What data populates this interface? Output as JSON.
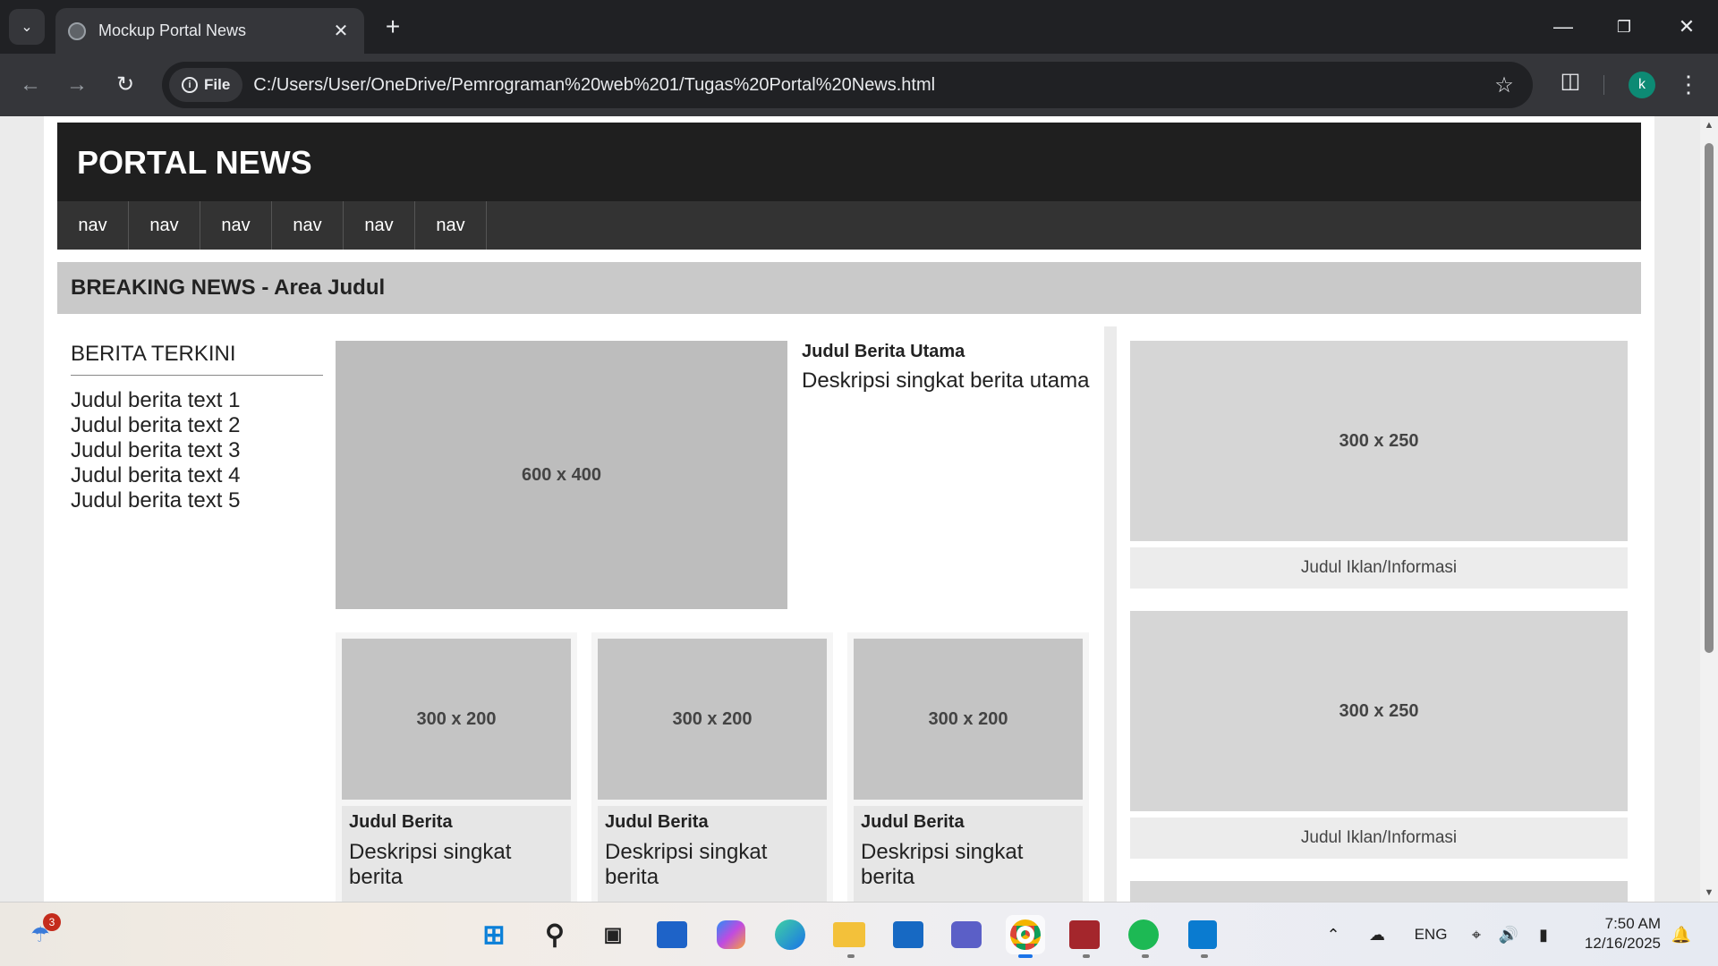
{
  "browser": {
    "tab_title": "Mockup Portal News",
    "new_tab_symbol": "+",
    "close_symbol": "✕",
    "site_chip_label": "File",
    "url": "C:/Users/User/OneDrive/Pemrograman%20web%201/Tugas%20Portal%20News.html",
    "profile_initial": "k"
  },
  "site": {
    "title": "PORTAL NEWS",
    "nav": [
      "nav",
      "nav",
      "nav",
      "nav",
      "nav",
      "nav"
    ],
    "breaking": "BREAKING NEWS - Area Judul"
  },
  "berita_terkini": {
    "title": "BERITA TERKINI",
    "items": [
      "Judul berita text 1",
      "Judul berita text 2",
      "Judul berita text 3",
      "Judul berita text 4",
      "Judul berita text 5"
    ]
  },
  "hero": {
    "image_label": "600 x 400",
    "title": "Judul Berita Utama",
    "description": "Deskripsi singkat berita utama"
  },
  "cards": [
    {
      "image_label": "300 x 200",
      "title": "Judul Berita",
      "description": "Deskripsi singkat berita"
    },
    {
      "image_label": "300 x 200",
      "title": "Judul Berita",
      "description": "Deskripsi singkat berita"
    },
    {
      "image_label": "300 x 200",
      "title": "Judul Berita",
      "description": "Deskripsi singkat berita"
    }
  ],
  "ads": [
    {
      "image_label": "300 x 250",
      "caption": "Judul Iklan/Informasi"
    },
    {
      "image_label": "300 x 250",
      "caption": "Judul Iklan/Informasi"
    }
  ],
  "taskbar": {
    "notification_count": "3",
    "language": "ENG",
    "time": "7:50 AM",
    "date": "12/16/2025"
  }
}
